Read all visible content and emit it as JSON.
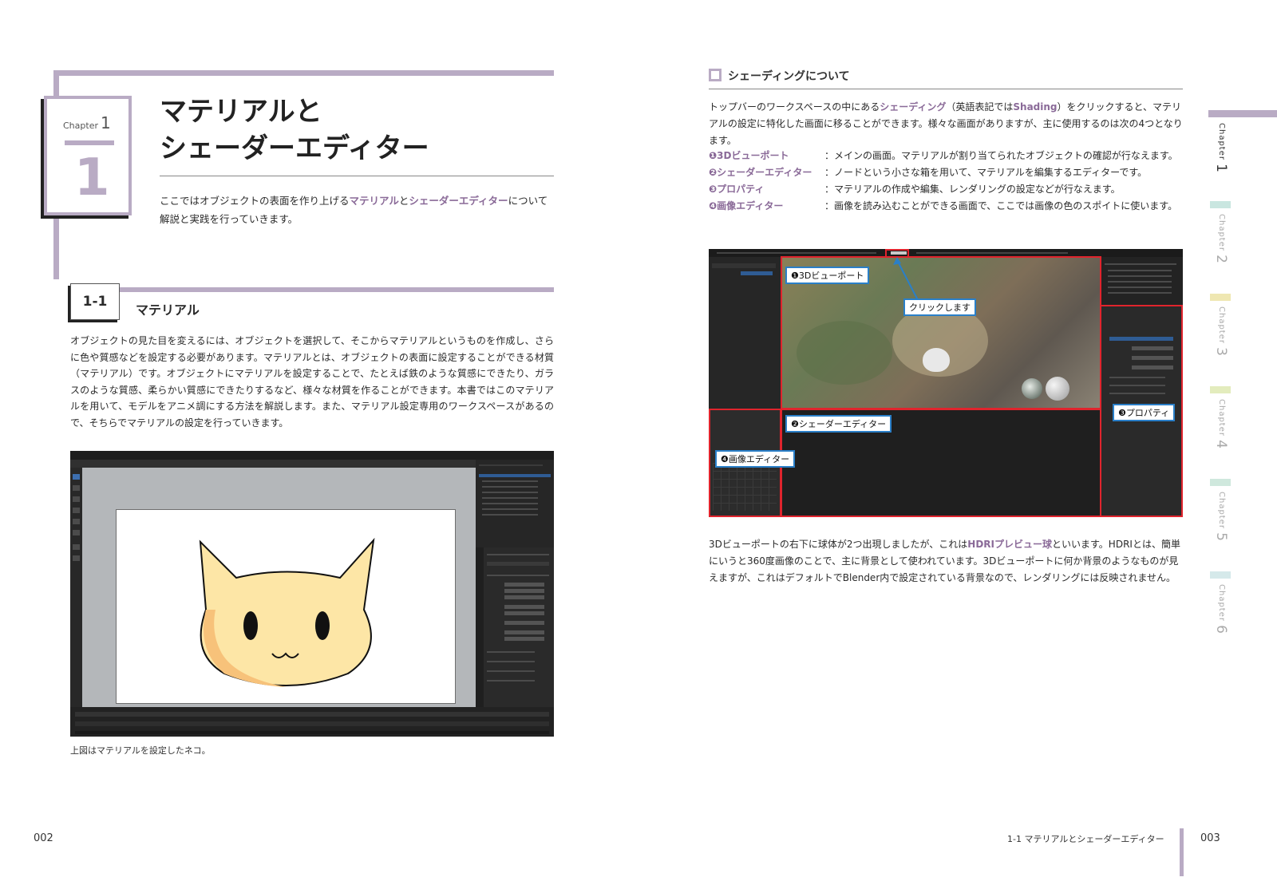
{
  "left_page": {
    "chapter_label": "Chapter",
    "chapter_num": "1",
    "chapter_big": "1",
    "title_line1": "マテリアルと",
    "title_line2": "シェーダーエディター",
    "intro": {
      "t1": "ここではオブジェクトの表面を作り上げる",
      "k1": "マテリアル",
      "t2": "と",
      "k2": "シェーダーエディター",
      "t3": "について解説と実践を行っていきます。"
    },
    "section_num": "1-1",
    "section_title": "マテリアル",
    "body": "オブジェクトの見た目を変えるには、オブジェクトを選択して、そこからマテリアルというものを作成し、さらに色や質感などを設定する必要があります。マテリアルとは、オブジェクトの表面に設定することができる材質（マテリアル）です。オブジェクトにマテリアルを設定することで、たとえば鉄のような質感にできたり、ガラスのような質感、柔らかい質感にできたりするなど、様々な材質を作ることができます。本書ではこのマテリアルを用いて、モデルをアニメ調にする方法を解説します。また、マテリアル設定専用のワークスペースがあるので、そちらでマテリアルの設定を行っていきます。",
    "caption": "上図はマテリアルを設定したネコ。",
    "page_number": "002"
  },
  "right_page": {
    "heading": "シェーディングについて",
    "body1": {
      "t1": "トップバーのワークスペースの中にある",
      "k1": "シェーディング",
      "t2": "（英語表記では",
      "k2": "Shading",
      "t3": "）をクリックすると、マテリアルの設定に特化した画面に移ることができます。様々な画面がありますが、主に使用するのは次の4つとなります。"
    },
    "items": [
      {
        "key": "❶3Dビューポート",
        "desc": "：メインの画面。マテリアルが割り当てられたオブジェクトの確認が行なえます。"
      },
      {
        "key": "❷シェーダーエディター",
        "desc": "：ノードという小さな箱を用いて、マテリアルを編集するエディターです。"
      },
      {
        "key": "❸プロパティ",
        "desc": "：マテリアルの作成や編集、レンダリングの設定などが行なえます。"
      },
      {
        "key": "❹画像エディター",
        "desc": "：画像を読み込むことができる画面で、ここでは画像の色のスポイトに使います。"
      }
    ],
    "callouts": {
      "viewport": "❶3Dビューポート",
      "click": "クリックします",
      "shader": "❷シェーダーエディター",
      "properties": "❸プロパティ",
      "image": "❹画像エディター"
    },
    "body2": {
      "t1": "3Dビューポートの右下に球体が2つ出現しましたが、これは",
      "k1": "HDRIプレビュー球",
      "t2": "といいます。HDRIとは、簡単にいうと360度画像のことで、主に背景として使われています。3Dビューポートに何か背景のようなものが見えますが、これはデフォルトでBlender内で設定されている背景なので、レンダリングには反映されません。"
    },
    "footer_title": "1-1 マテリアルとシェーダーエディター",
    "page_number": "003"
  },
  "chapter_index": [
    {
      "label": "Chapter",
      "num": "1",
      "color": "#b9abc4",
      "active": true
    },
    {
      "label": "Chapter",
      "num": "2",
      "color": "#c9e6e0"
    },
    {
      "label": "Chapter",
      "num": "3",
      "color": "#efe7b2"
    },
    {
      "label": "Chapter",
      "num": "4",
      "color": "#e3ecbd"
    },
    {
      "label": "Chapter",
      "num": "5",
      "color": "#cfe8dd"
    },
    {
      "label": "Chapter",
      "num": "6",
      "color": "#d5e9ea"
    }
  ],
  "colors": {
    "accent": "#b9abc4",
    "keyword": "#8a6a98",
    "highlight_box": "#e0242d",
    "callout_border": "#2a7fc8"
  }
}
